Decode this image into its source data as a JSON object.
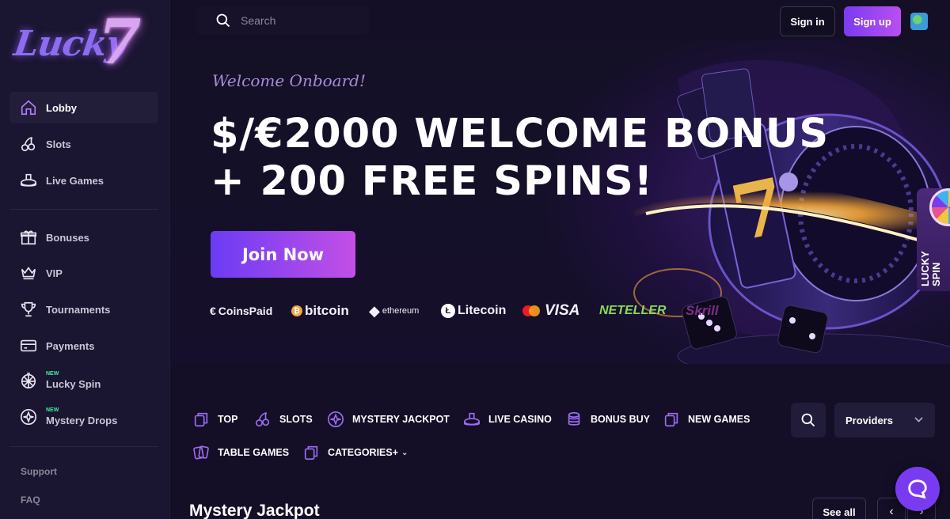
{
  "brand": {
    "logo_text": "Lucky",
    "logo_seven": "7"
  },
  "sidebar": {
    "items": [
      {
        "label": "Lobby",
        "icon": "home-icon",
        "active": true
      },
      {
        "label": "Slots",
        "icon": "cherries-icon"
      },
      {
        "label": "Live Games",
        "icon": "card-table-icon"
      },
      {
        "label": "Bonuses",
        "icon": "gift-icon"
      },
      {
        "label": "VIP",
        "icon": "crown-icon"
      },
      {
        "label": "Tournaments",
        "icon": "trophy-icon"
      },
      {
        "label": "Payments",
        "icon": "credit-card-icon"
      },
      {
        "label": "Lucky Spin",
        "icon": "wheel-icon",
        "badge": "NEW"
      },
      {
        "label": "Mystery Drops",
        "icon": "mystery-icon",
        "badge": "NEW"
      }
    ],
    "footer": {
      "support": "Support",
      "faq": "FAQ"
    }
  },
  "header": {
    "search_placeholder": "Search",
    "signin_label": "Sign in",
    "signup_label": "Sign up",
    "language_icon": "globe-flag-icon"
  },
  "hero": {
    "welcome": "Welcome Onboard!",
    "headline_line1": "$/€2000 WELCOME BONUS",
    "headline_line2": "+ 200 FREE SPINS!",
    "cta_label": "Join Now",
    "payment_methods": [
      "CoinsPaid",
      "bitcoin",
      "ethereum",
      "Litecoin",
      "VISA",
      "NETELLER",
      "Skrill"
    ],
    "side_tab_label": "LUCKY SPIN"
  },
  "categories": {
    "items": [
      {
        "label": "TOP",
        "icon": "cards-icon"
      },
      {
        "label": "SLOTS",
        "icon": "cherries-icon"
      },
      {
        "label": "MYSTERY JACKPOT",
        "icon": "star-badge-icon"
      },
      {
        "label": "LIVE CASINO",
        "icon": "card-table-icon"
      },
      {
        "label": "BONUS BUY",
        "icon": "chips-icon"
      },
      {
        "label": "NEW GAMES",
        "icon": "cards-icon"
      },
      {
        "label": "TABLE GAMES",
        "icon": "playing-cards-icon"
      },
      {
        "label": "CATEGORIES+",
        "icon": "cards-icon"
      }
    ],
    "providers_label": "Providers"
  },
  "section": {
    "title": "Mystery Jackpot",
    "see_all": "See all"
  },
  "colors": {
    "accent": "#7a3bf0",
    "accent2": "#c44fe6",
    "bg": "#140f26",
    "sidebar": "#1a1530",
    "new_badge": "#3ff0a0"
  }
}
